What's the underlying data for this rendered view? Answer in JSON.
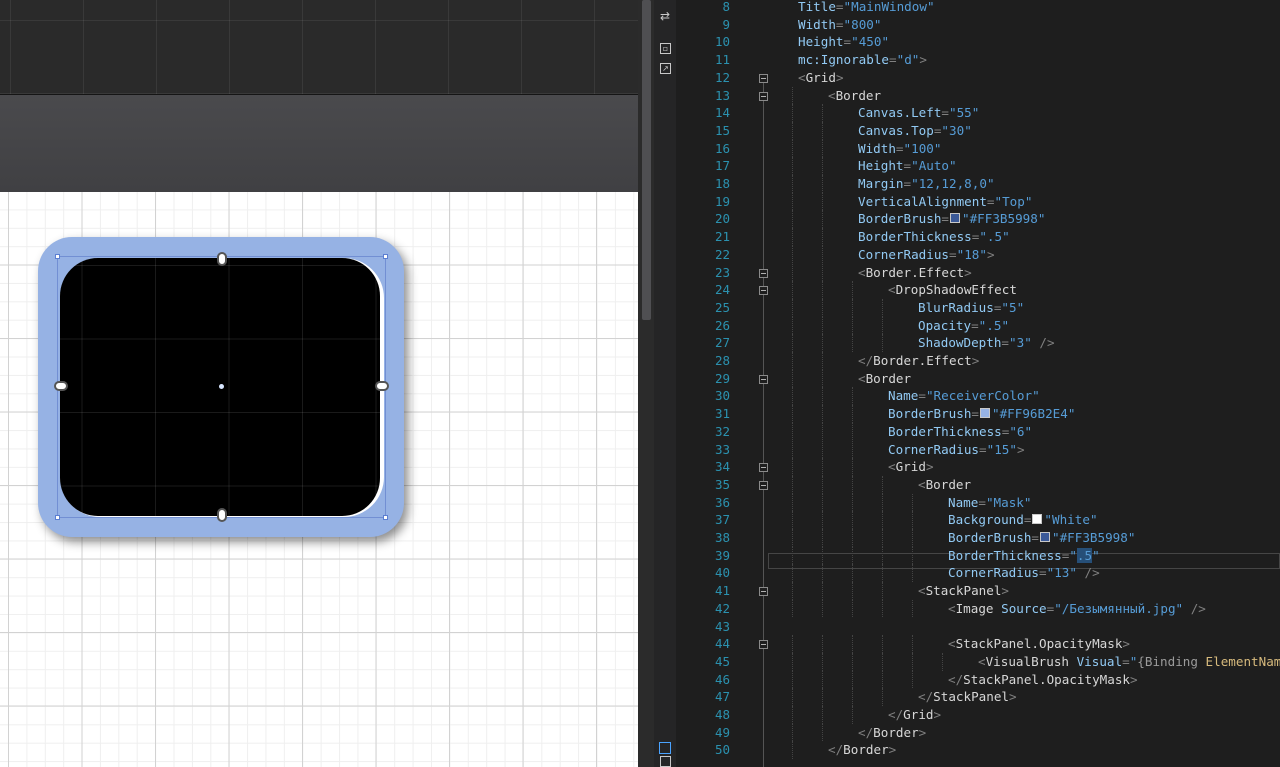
{
  "designer": {
    "outer_border_color": "#96B2E4",
    "image_color": "#000000"
  },
  "editor": {
    "lines": [
      {
        "n": "8",
        "indent": 1,
        "kind": "attr",
        "attr": "Title",
        "value": "MainWindow"
      },
      {
        "n": "9",
        "indent": 1,
        "kind": "attr",
        "attr": "Width",
        "value": "800"
      },
      {
        "n": "10",
        "indent": 1,
        "kind": "attr",
        "attr": "Height",
        "value": "450"
      },
      {
        "n": "11",
        "indent": 1,
        "kind": "attr",
        "attr": "mc:Ignorable",
        "value": "d",
        "close": ">"
      },
      {
        "n": "12",
        "indent": 1,
        "kind": "open",
        "elem": "Grid"
      },
      {
        "n": "13",
        "indent": 2,
        "kind": "openstart",
        "elem": "Border"
      },
      {
        "n": "14",
        "indent": 3,
        "kind": "attr",
        "attr": "Canvas.Left",
        "value": "55"
      },
      {
        "n": "15",
        "indent": 3,
        "kind": "attr",
        "attr": "Canvas.Top",
        "value": "30"
      },
      {
        "n": "16",
        "indent": 3,
        "kind": "attr",
        "attr": "Width",
        "value": "100"
      },
      {
        "n": "17",
        "indent": 3,
        "kind": "attr",
        "attr": "Height",
        "value": "Auto"
      },
      {
        "n": "18",
        "indent": 3,
        "kind": "attr",
        "attr": "Margin",
        "value": "12,12,8,0"
      },
      {
        "n": "19",
        "indent": 3,
        "kind": "attr",
        "attr": "VerticalAlignment",
        "value": "Top"
      },
      {
        "n": "20",
        "indent": 3,
        "kind": "attr",
        "attr": "BorderBrush",
        "value": "#FF3B5998",
        "swatch": "#3B5998"
      },
      {
        "n": "21",
        "indent": 3,
        "kind": "attr",
        "attr": "BorderThickness",
        "value": ".5"
      },
      {
        "n": "22",
        "indent": 3,
        "kind": "attr",
        "attr": "CornerRadius",
        "value": "18",
        "close": ">"
      },
      {
        "n": "23",
        "indent": 3,
        "kind": "open",
        "elem": "Border.Effect"
      },
      {
        "n": "24",
        "indent": 4,
        "kind": "openstart",
        "elem": "DropShadowEffect"
      },
      {
        "n": "25",
        "indent": 5,
        "kind": "attr",
        "attr": "BlurRadius",
        "value": "5"
      },
      {
        "n": "26",
        "indent": 5,
        "kind": "attr",
        "attr": "Opacity",
        "value": ".5"
      },
      {
        "n": "27",
        "indent": 5,
        "kind": "attr",
        "attr": "ShadowDepth",
        "value": "3",
        "close": " />"
      },
      {
        "n": "28",
        "indent": 3,
        "kind": "close",
        "elem": "Border.Effect"
      },
      {
        "n": "29",
        "indent": 3,
        "kind": "openstart",
        "elem": "Border"
      },
      {
        "n": "30",
        "indent": 4,
        "kind": "attr",
        "attr": "Name",
        "value": "ReceiverColor"
      },
      {
        "n": "31",
        "indent": 4,
        "kind": "attr",
        "attr": "BorderBrush",
        "value": "#FF96B2E4",
        "swatch": "#96B2E4"
      },
      {
        "n": "32",
        "indent": 4,
        "kind": "attr",
        "attr": "BorderThickness",
        "value": "6"
      },
      {
        "n": "33",
        "indent": 4,
        "kind": "attr",
        "attr": "CornerRadius",
        "value": "15",
        "close": ">"
      },
      {
        "n": "34",
        "indent": 4,
        "kind": "open",
        "elem": "Grid"
      },
      {
        "n": "35",
        "indent": 5,
        "kind": "openstart",
        "elem": "Border"
      },
      {
        "n": "36",
        "indent": 6,
        "kind": "attr",
        "attr": "Name",
        "value": "Mask"
      },
      {
        "n": "37",
        "indent": 6,
        "kind": "attr",
        "attr": "Background",
        "value": "White",
        "swatch": "#FFFFFF"
      },
      {
        "n": "38",
        "indent": 6,
        "kind": "attr",
        "attr": "BorderBrush",
        "value": "#FF3B5998",
        "swatch": "#3B5998"
      },
      {
        "n": "39",
        "indent": 6,
        "kind": "attr",
        "attr": "BorderThickness",
        "value": ".5",
        "selected": true
      },
      {
        "n": "40",
        "indent": 6,
        "kind": "attr",
        "attr": "CornerRadius",
        "value": "13",
        "close": " />"
      },
      {
        "n": "41",
        "indent": 5,
        "kind": "open",
        "elem": "StackPanel"
      },
      {
        "n": "42",
        "indent": 6,
        "kind": "inline",
        "elem": "Image",
        "attr": "Source",
        "value": "/Безымянный.jpg",
        "close": " />"
      },
      {
        "n": "43",
        "indent": 0,
        "kind": "blank"
      },
      {
        "n": "44",
        "indent": 6,
        "kind": "open",
        "elem": "StackPanel.OpacityMask"
      },
      {
        "n": "45",
        "indent": 7,
        "kind": "binding",
        "elem": "VisualBrush",
        "attr": "Visual",
        "binding_kw": "{Binding",
        "binding_rest": " ElementName"
      },
      {
        "n": "46",
        "indent": 6,
        "kind": "close",
        "elem": "StackPanel.OpacityMask"
      },
      {
        "n": "47",
        "indent": 5,
        "kind": "close",
        "elem": "StackPanel"
      },
      {
        "n": "48",
        "indent": 4,
        "kind": "close",
        "elem": "Grid"
      },
      {
        "n": "49",
        "indent": 3,
        "kind": "close",
        "elem": "Border"
      },
      {
        "n": "50",
        "indent": 2,
        "kind": "close",
        "elem": "Border"
      }
    ]
  }
}
